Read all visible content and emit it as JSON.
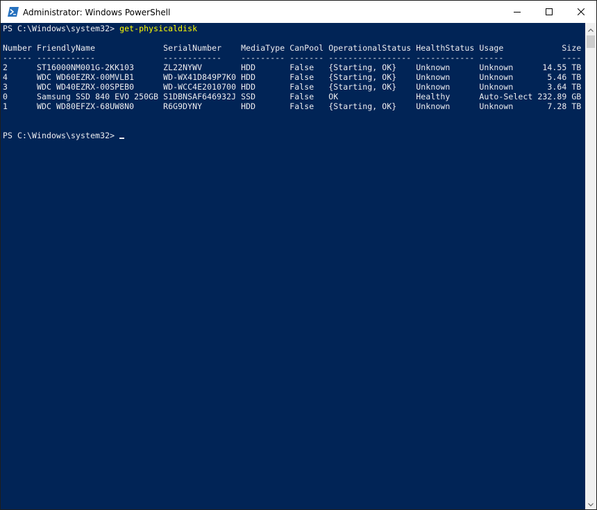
{
  "window": {
    "title": "Administrator: Windows PowerShell"
  },
  "console": {
    "prompt1": "PS C:\\Windows\\system32> ",
    "command1": "get-physicaldisk",
    "header": "Number FriendlyName              SerialNumber    MediaType CanPool OperationalStatus HealthStatus Usage            Size",
    "separator": "------ ------------              ------------    --------- ------- ----------------- ------------ -----            ----",
    "rows": [
      "2      ST16000NM001G-2KK103      ZL22NYWV        HDD       False   {Starting, OK}    Unknown      Unknown      14.55 TB",
      "4      WDC WD60EZRX-00MVLB1      WD-WX41D849P7K0 HDD       False   {Starting, OK}    Unknown      Unknown       5.46 TB",
      "3      WDC WD40EZRX-00SPEB0      WD-WCC4E2010700 HDD       False   {Starting, OK}    Unknown      Unknown       3.64 TB",
      "0      Samsung SSD 840 EVO 250GB S1DBNSAF646932J SSD       False   OK                Healthy      Auto-Select 232.89 GB",
      "1      WDC WD80EFZX-68UW8N0      R6G9DYNY        HDD       False   {Starting, OK}    Unknown      Unknown       7.28 TB"
    ],
    "prompt2": "PS C:\\Windows\\system32>"
  },
  "icons": {
    "app": "powershell-icon",
    "minimize": "minimize-icon",
    "maximize": "maximize-icon",
    "close": "close-icon",
    "scroll_up": "arrow-up-icon",
    "scroll_down": "arrow-down-icon"
  },
  "colors": {
    "console_background": "#012456",
    "console_text": "#eeedf0",
    "command_text": "#ffff00"
  }
}
